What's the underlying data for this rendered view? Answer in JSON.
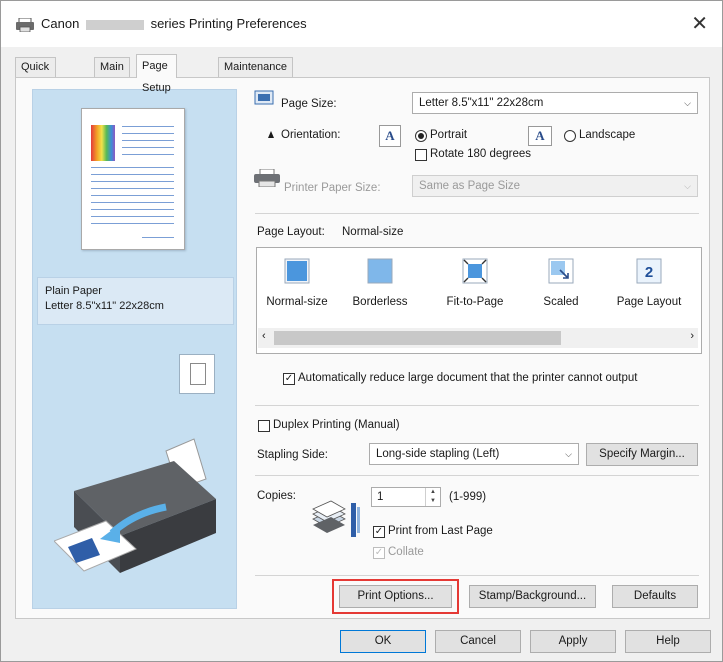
{
  "window": {
    "title_prefix": "Canon",
    "title_suffix": "series Printing Preferences",
    "close_label": "✕"
  },
  "tabs": [
    "Quick Setup",
    "Main",
    "Page Setup",
    "Maintenance"
  ],
  "active_tab": "Page Setup",
  "preview": {
    "media_type": "Plain Paper",
    "paper_size": "Letter 8.5\"x11\" 22x28cm"
  },
  "page_size": {
    "label": "Page Size:",
    "value": "Letter 8.5\"x11\" 22x28cm"
  },
  "orientation": {
    "label": "Orientation:",
    "portrait_label": "Portrait",
    "landscape_label": "Landscape",
    "selected": "Portrait",
    "rotate_label": "Rotate 180 degrees",
    "rotate_checked": false
  },
  "printer_paper_size": {
    "label": "Printer Paper Size:",
    "value": "Same as Page Size",
    "disabled": true
  },
  "page_layout": {
    "label": "Page Layout:",
    "value": "Normal-size",
    "items": [
      "Normal-size",
      "Borderless",
      "Fit-to-Page",
      "Scaled",
      "Page Layout"
    ]
  },
  "auto_reduce": {
    "label": "Automatically reduce large document that the printer cannot output",
    "checked": true
  },
  "duplex": {
    "label": "Duplex Printing (Manual)",
    "checked": false
  },
  "stapling": {
    "label": "Stapling Side:",
    "value": "Long-side stapling (Left)",
    "margin_button": "Specify Margin..."
  },
  "copies": {
    "label": "Copies:",
    "value": "1",
    "range": "(1-999)",
    "print_from_last_label": "Print from Last Page",
    "print_from_last_checked": true,
    "collate_label": "Collate",
    "collate_checked": true,
    "collate_disabled": true
  },
  "buttons": {
    "print_options": "Print Options...",
    "stamp_background": "Stamp/Background...",
    "defaults": "Defaults",
    "ok": "OK",
    "cancel": "Cancel",
    "apply": "Apply",
    "help": "Help"
  },
  "icons": {
    "page_size": "page-size-icon",
    "orientation": "orientation-icon",
    "printer_paper_size": "printer-paper-size-icon",
    "copies": "copies-icon"
  },
  "colors": {
    "preview_bg": "#c6dff1",
    "highlight": "#e53935",
    "accent": "#0078d7"
  }
}
